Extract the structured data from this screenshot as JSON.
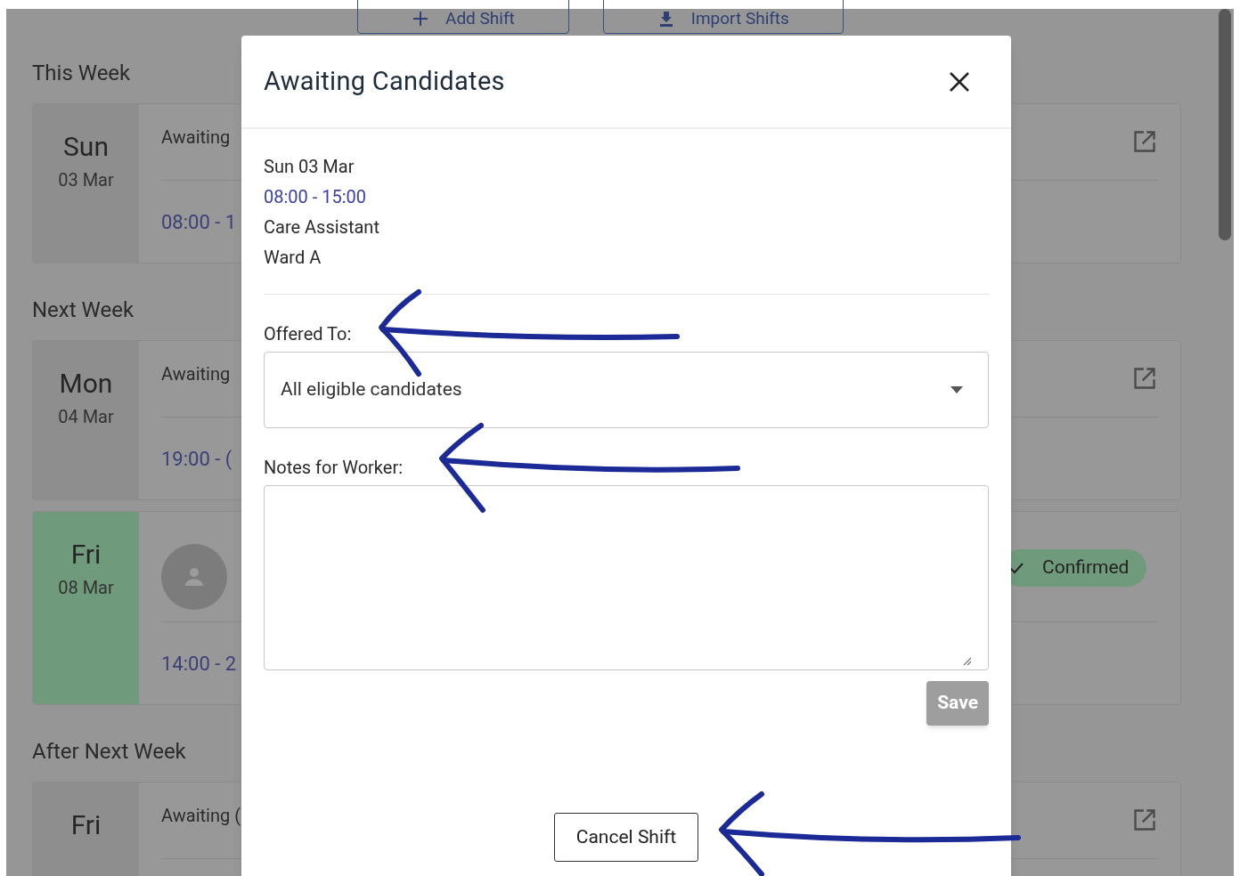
{
  "toolbar_buttons": [
    {
      "kind": "add",
      "label": "Add Shift"
    },
    {
      "kind": "import",
      "label": "Import Shifts"
    }
  ],
  "sections": [
    {
      "title": "This Week",
      "shifts": [
        {
          "day": "Sun",
          "date": "03 Mar",
          "status": "Awaiting",
          "time": "08:00 - 1",
          "confirmed": false
        }
      ]
    },
    {
      "title": "Next Week",
      "shifts": [
        {
          "day": "Mon",
          "date": "04 Mar",
          "status": "Awaiting",
          "time": "19:00 - (",
          "confirmed": false
        },
        {
          "day": "Fri",
          "date": "08 Mar",
          "time": "14:00 - 2",
          "confirmed": true,
          "badge": "Confirmed"
        }
      ]
    },
    {
      "title": "After Next Week",
      "shifts": [
        {
          "day": "Fri",
          "status": "Awaiting (",
          "confirmed": false
        }
      ]
    }
  ],
  "modal": {
    "title": "Awaiting Candidates",
    "details": [
      {
        "kind": "date",
        "text": "Sun 03 Mar"
      },
      {
        "kind": "time",
        "text": "08:00 - 15:00"
      },
      {
        "kind": "role",
        "text": "Care Assistant"
      },
      {
        "kind": "ward",
        "text": "Ward A"
      }
    ],
    "offered_label": "Offered To:",
    "offered_value": "All eligible candidates",
    "notes_label": "Notes for Worker:",
    "save_label": "Save",
    "save_disabled": true,
    "cancel_label": "Cancel Shift"
  }
}
